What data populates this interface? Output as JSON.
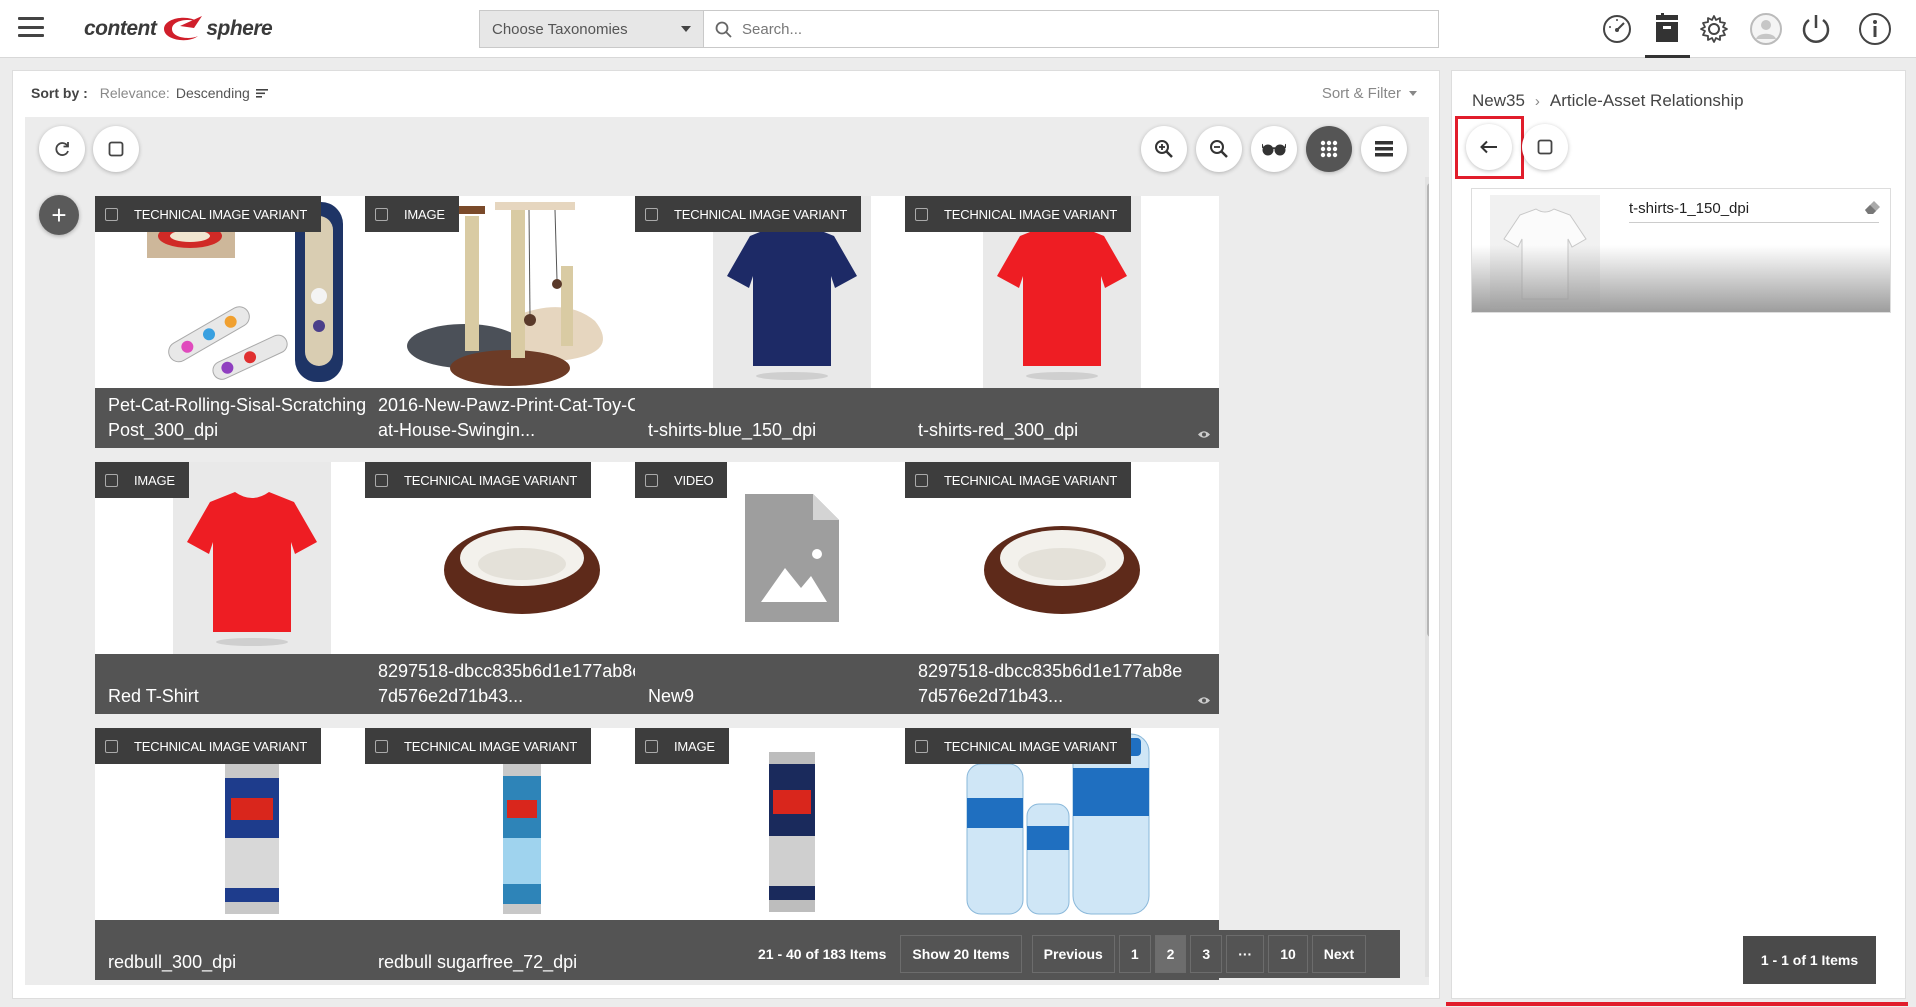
{
  "header": {
    "logo_text_left": "content",
    "logo_text_right": "sphere",
    "taxonomy_select": "Choose Taxonomies",
    "search_placeholder": "Search..."
  },
  "sortbar": {
    "title": "Sort by :",
    "relevance_label": "Relevance:",
    "relevance_value": "Descending",
    "sort_filter_label": "Sort & Filter"
  },
  "cards": [
    {
      "tag": "TECHNICAL IMAGE VARIANT",
      "name": "Pet-Cat-Rolling-Sisal-Scratching-Post_300_dpi",
      "thumb": "cat-toy"
    },
    {
      "tag": "IMAGE",
      "name": "2016-New-Pawz-Print-Cat-Toy-Cat-House-Swingin...",
      "thumb": "cat-tree"
    },
    {
      "tag": "TECHNICAL IMAGE VARIANT",
      "name": "t-shirts-blue_150_dpi",
      "thumb": "tshirt-blue"
    },
    {
      "tag": "TECHNICAL IMAGE VARIANT",
      "name": "t-shirts-red_300_dpi",
      "thumb": "tshirt-red"
    },
    {
      "tag": "IMAGE",
      "name": "Red T-Shirt",
      "thumb": "tshirt-red"
    },
    {
      "tag": "TECHNICAL IMAGE VARIANT",
      "name": "8297518-dbcc835b6d1e177ab8e7d576e2d71b43...",
      "thumb": "pet-bed"
    },
    {
      "tag": "VIDEO",
      "name": "New9",
      "thumb": "placeholder-file"
    },
    {
      "tag": "TECHNICAL IMAGE VARIANT",
      "name": "8297518-dbcc835b6d1e177ab8e7d576e2d71b43...",
      "thumb": "pet-bed"
    },
    {
      "tag": "TECHNICAL IMAGE VARIANT",
      "name": "redbull_300_dpi",
      "thumb": "can-blue"
    },
    {
      "tag": "TECHNICAL IMAGE VARIANT",
      "name": "redbull sugarfree_72_dpi",
      "thumb": "can-light"
    },
    {
      "tag": "IMAGE",
      "name": "",
      "thumb": "can-dark"
    },
    {
      "tag": "TECHNICAL IMAGE VARIANT",
      "name": "",
      "thumb": "water-bottles"
    }
  ],
  "pager": {
    "info": "21 - 40 of 183 Items",
    "show": "Show 20 Items",
    "previous": "Previous",
    "p1": "1",
    "p2": "2",
    "p3": "3",
    "ellipsis": "···",
    "p10": "10",
    "next": "Next"
  },
  "right_panel": {
    "crumb_parent": "New35",
    "crumb_current": "Article-Asset Relationship",
    "item_name": "t-shirts-1_150_dpi",
    "count": "1 - 1 of 1 Items"
  }
}
